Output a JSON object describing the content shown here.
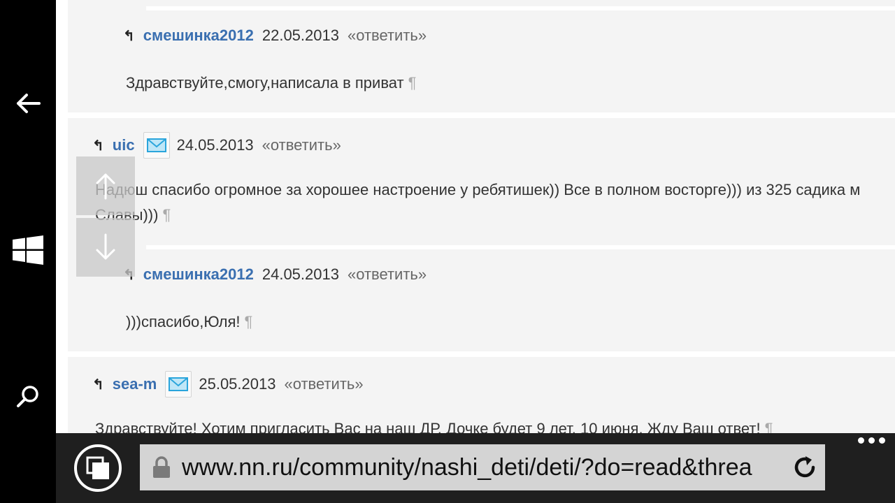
{
  "comments": [
    {
      "author": "смешинка2012",
      "date": "22.05.2013",
      "reply": "«ответить»",
      "text": "Здравствуйте,смогу,написала в приват",
      "has_mail": false
    },
    {
      "author": "uic",
      "date": "24.05.2013",
      "reply": "«ответить»",
      "text_line1": "Надюш спасибо огромное за хорошее настроение у ребятишек)) Все в полном восторге))) из 325 садика м",
      "text_line2": "Славы)))",
      "has_mail": true
    },
    {
      "author": "смешинка2012",
      "date": "24.05.2013",
      "reply": "«ответить»",
      "text": ")))спасибо,Юля!",
      "has_mail": false
    },
    {
      "author": "sea-m",
      "date": "25.05.2013",
      "reply": "«ответить»",
      "text": "Здравствуйте! Хотим пригласить Вас на наш ДР. Дочке будет 9 лет. 10 июня. Жду Ваш ответ!",
      "has_mail": true
    }
  ],
  "pilcrow": "¶",
  "reply_glyph": "↰",
  "browser": {
    "url": "www.nn.ru/community/nashi_deti/deti/?do=read&threa"
  },
  "icons": {
    "nav_back": "back-arrow-icon",
    "nav_windows": "windows-logo-icon",
    "nav_search": "search-icon",
    "tabs": "tabs-icon",
    "lock": "lock-icon",
    "refresh": "refresh-icon",
    "more": "more-dots-icon",
    "mail": "mail-icon",
    "scroll_up": "arrow-up-icon",
    "scroll_down": "arrow-down-icon"
  },
  "colors": {
    "author": "#3a6fb0",
    "block_bg": "#f4f4f4",
    "bar_bg": "#1f1f1f",
    "address_bg": "#d4d4d4"
  }
}
